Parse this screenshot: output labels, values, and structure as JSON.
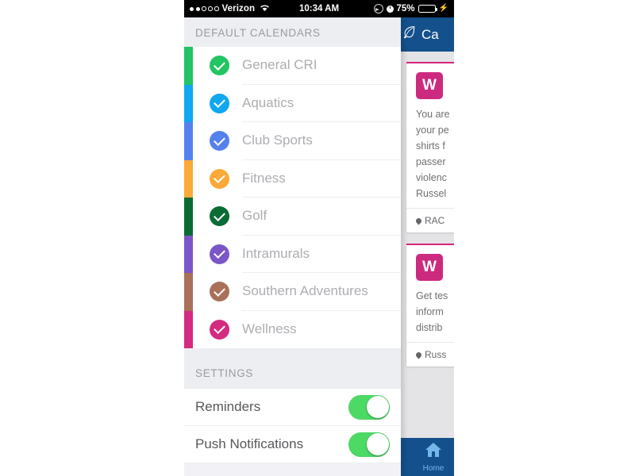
{
  "statusbar": {
    "carrier": "Verizon",
    "time": "10:34 AM",
    "battery_percent": "75%",
    "signal_filled_dots": 2,
    "signal_total_dots": 5,
    "icons": [
      "wifi-icon",
      "location-icon",
      "alarm-icon",
      "battery-icon",
      "charging-bolt-icon"
    ]
  },
  "drawer": {
    "sections": [
      {
        "id": "calendars",
        "title": "DEFAULT CALENDARS"
      },
      {
        "id": "settings",
        "title": "SETTINGS"
      }
    ],
    "calendars": [
      {
        "label": "General CRI",
        "color": "#22c464",
        "bar_color": "#22c464",
        "checked": true
      },
      {
        "label": "Aquatics",
        "color": "#0fa7ef",
        "bar_color": "#0fa7ef",
        "checked": true
      },
      {
        "label": "Club Sports",
        "color": "#5581ef",
        "bar_color": "#5581ef",
        "checked": true
      },
      {
        "label": "Fitness",
        "color": "#fca93a",
        "bar_color": "#fca93a",
        "checked": true
      },
      {
        "label": "Golf",
        "color": "#0a6b35",
        "bar_color": "#0a6b35",
        "checked": true
      },
      {
        "label": "Intramurals",
        "color": "#7a56c8",
        "bar_color": "#7a56c8",
        "checked": true
      },
      {
        "label": "Southern Adventures",
        "color": "#a9705a",
        "bar_color": "#a9705a",
        "checked": true
      },
      {
        "label": "Wellness",
        "color": "#d42a80",
        "bar_color": "#d42a80",
        "checked": true
      }
    ],
    "settings": [
      {
        "label": "Reminders",
        "on": true
      },
      {
        "label": "Push Notifications",
        "on": true
      }
    ],
    "toggle_on_color": "#4cd964"
  },
  "feed": {
    "header": {
      "title": "Ca",
      "logo": "leaf-icon",
      "bg_color": "#14508c"
    },
    "accent_color": "#d6267f",
    "cards": [
      {
        "badge": "W",
        "text_lines": [
          "You are",
          "your pe",
          "shirts f",
          "passer",
          "violenc",
          "Russel"
        ],
        "location": "RAC"
      },
      {
        "badge": "W",
        "text_lines": [
          "Get tes",
          "inform",
          "distrib"
        ],
        "location": "Russ"
      }
    ],
    "tabbar": {
      "home_label": "Home",
      "icon": "home-icon"
    }
  }
}
